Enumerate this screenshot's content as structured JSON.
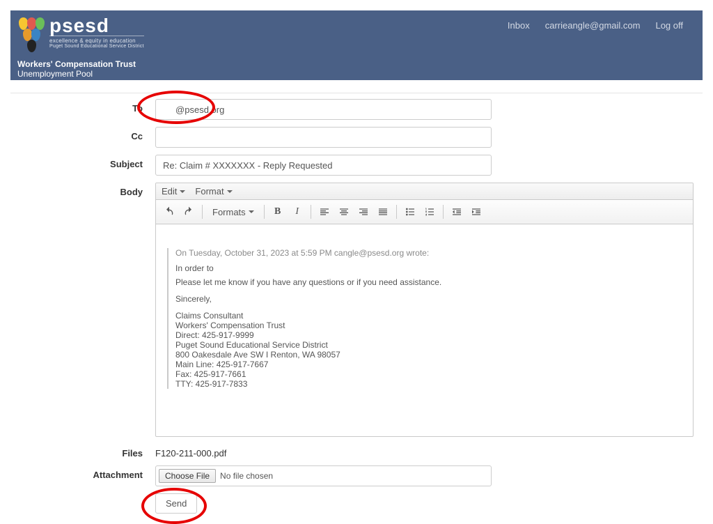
{
  "header": {
    "brand_main": "psesd",
    "brand_sub1": "excellence & equity in education",
    "brand_sub2": "Puget Sound Educational Service District",
    "brand_line3": "Workers' Compensation Trust",
    "brand_line4": "Unemployment Pool",
    "nav": {
      "inbox": "Inbox",
      "user": "carrieangle@gmail.com",
      "logoff": "Log off"
    }
  },
  "labels": {
    "to": "To",
    "cc": "Cc",
    "subject": "Subject",
    "body": "Body",
    "files": "Files",
    "attachment": "Attachment"
  },
  "fields": {
    "to_value": "     @psesd.org",
    "cc_value": "",
    "subject_value": "Re: Claim # XXXXXXX - Reply Requested"
  },
  "editor": {
    "menu_edit": "Edit",
    "menu_format": "Format",
    "toolbar_formats": "Formats",
    "body": {
      "quoted_header": "On Tuesday, October 31, 2023 at 5:59 PM cangle@psesd.org wrote:",
      "line_intro": "In order to",
      "line_help": "Please let me know if you have any questions or if you need assistance.",
      "line_sincerely": "Sincerely,",
      "sig_title": "Claims Consultant",
      "sig_org": "Workers' Compensation Trust",
      "sig_direct": "Direct: 425-917-9999",
      "sig_company": "Puget Sound Educational Service District",
      "sig_address": "800 Oakesdale Ave SW I Renton, WA 98057",
      "sig_main": "Main Line: 425-917-7667",
      "sig_fax": "Fax: 425-917-7661",
      "sig_tty": "TTY: 425-917-7833"
    }
  },
  "files": {
    "listed": "F120-211-000.pdf",
    "choose_btn": "Choose File",
    "no_file": "No file chosen"
  },
  "actions": {
    "send": "Send"
  }
}
